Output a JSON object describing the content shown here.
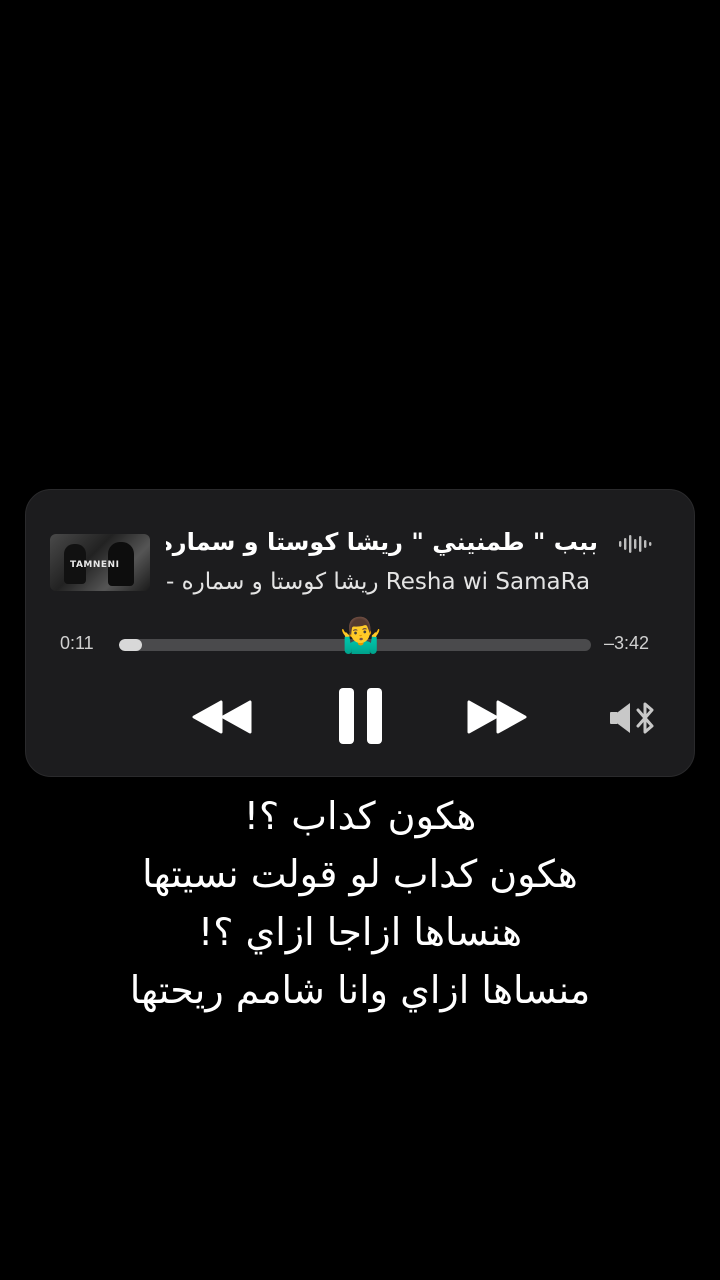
{
  "now_playing": {
    "title": "ببب \" طمنيني \" ريشا كوستا و سماره ناو",
    "subtitle_arabic": "ريشا كوستا و سماره -",
    "subtitle_latin": "Resha wi SamaRa",
    "artwork_label": "TAMNENI",
    "elapsed": "0:11",
    "remaining": "–3:42",
    "progress_fraction": 0.048,
    "progress_knob_emoji": "🤷‍♂️",
    "icons": {
      "playing_indicator": "waveform-icon",
      "rewind": "rewind-icon",
      "pause": "pause-icon",
      "forward": "fast-forward-icon",
      "audio_output": "speaker-bluetooth-icon"
    }
  },
  "lyrics": [
    "هكون كداب ؟!",
    "هكون كداب لو قولت نسيتها",
    "هنساها ازاجا ازاي ؟!",
    "منساها ازاي وانا شامم ريحتها"
  ]
}
